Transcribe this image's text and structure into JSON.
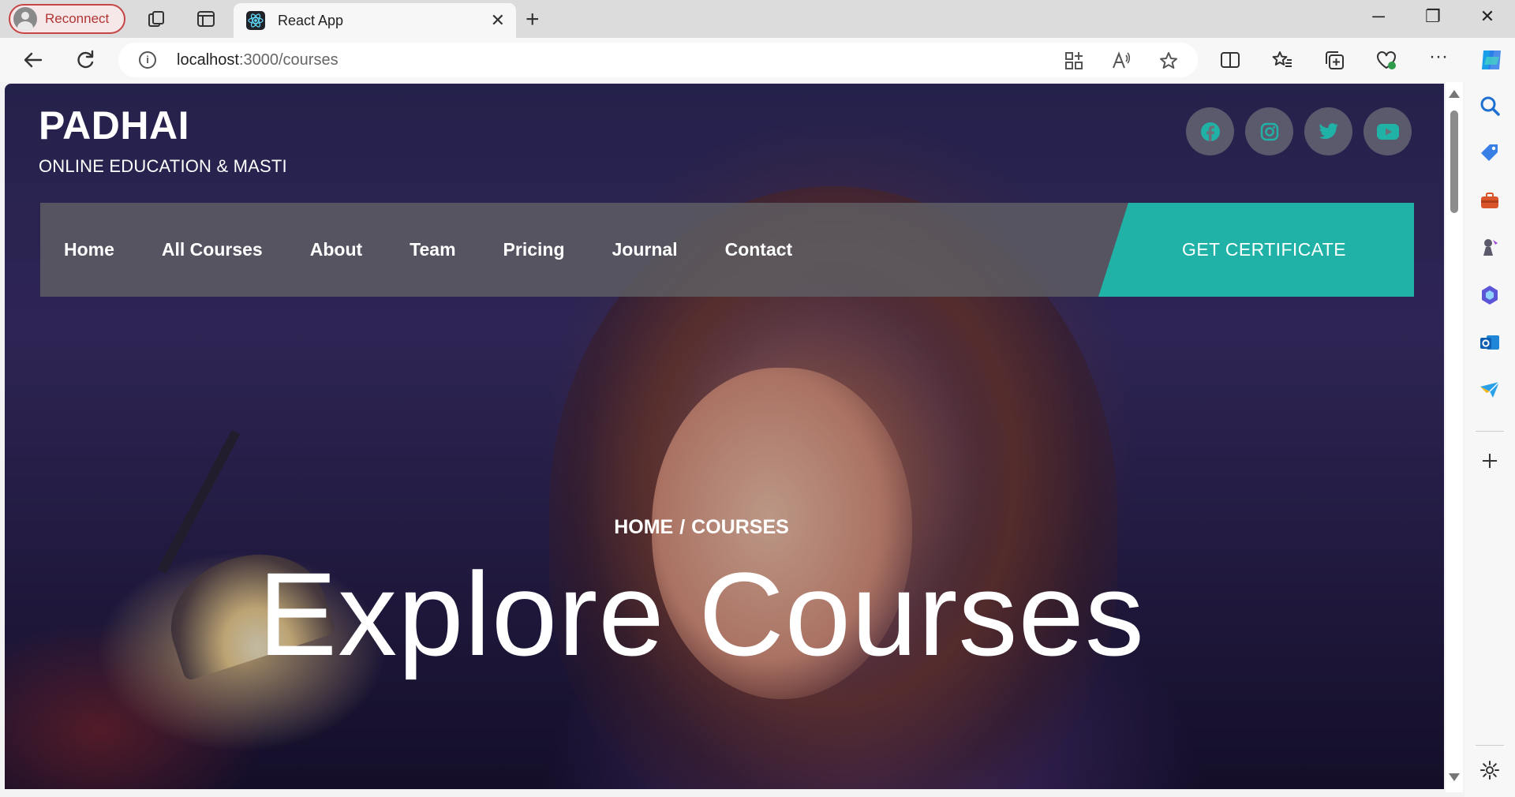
{
  "browser": {
    "profile_label": "Reconnect",
    "tab_title": "React App",
    "url_host": "localhost",
    "url_path": ":3000/courses"
  },
  "site": {
    "brand": "PADHAI",
    "tagline": "ONLINE EDUCATION & MASTI",
    "nav": [
      "Home",
      "All Courses",
      "About",
      "Team",
      "Pricing",
      "Journal",
      "Contact"
    ],
    "cta": "GET CERTIFICATE",
    "socials": [
      "facebook-icon",
      "instagram-icon",
      "twitter-icon",
      "youtube-icon"
    ],
    "social_icon_color": "#20b2a6",
    "accent": "#20b2a6"
  },
  "hero": {
    "crumb_home": "HOME",
    "crumb_sep": "/",
    "crumb_current": "COURSES",
    "title": "Explore Courses"
  }
}
